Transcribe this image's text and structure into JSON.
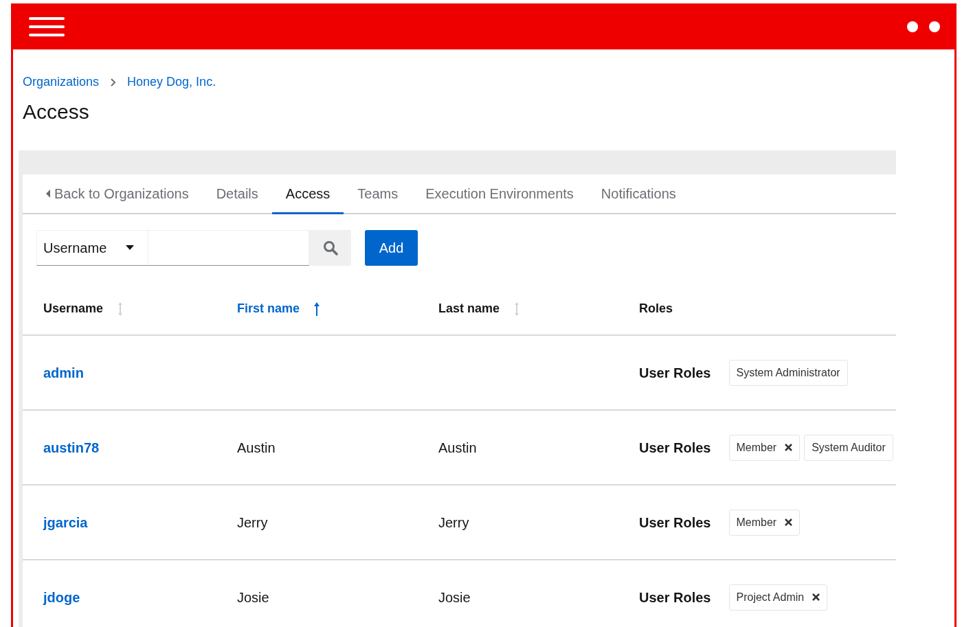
{
  "breadcrumb": [
    {
      "label": "Organizations"
    },
    {
      "label": "Honey Dog, Inc."
    }
  ],
  "title": "Access",
  "tabs": [
    {
      "label": "Back to Organizations",
      "kind": "back",
      "selected": false
    },
    {
      "label": "Details",
      "kind": "tab",
      "selected": false
    },
    {
      "label": "Access",
      "kind": "tab",
      "selected": true
    },
    {
      "label": "Teams",
      "kind": "tab",
      "selected": false
    },
    {
      "label": "Execution Environments",
      "kind": "tab",
      "selected": false
    },
    {
      "label": "Notifications",
      "kind": "tab",
      "selected": false
    }
  ],
  "toolbar": {
    "filter": "Username",
    "add_button": "Add"
  },
  "table": {
    "columns": [
      {
        "label": "Username",
        "sortable": true,
        "sorted": false
      },
      {
        "label": "First name",
        "sortable": true,
        "sorted": true
      },
      {
        "label": "Last name",
        "sortable": true,
        "sorted": false
      },
      {
        "label": "Roles",
        "sortable": false,
        "sorted": false
      }
    ],
    "rows": [
      {
        "username": "admin",
        "first_name": "",
        "last_name": "",
        "roles_label": "User Roles",
        "roles": [
          {
            "label": "System Administrator",
            "removable": false
          }
        ]
      },
      {
        "username": "austin78",
        "first_name": "Austin",
        "last_name": "Austin",
        "roles_label": "User Roles",
        "roles": [
          {
            "label": "Member",
            "removable": true
          },
          {
            "label": "System Auditor",
            "removable": false
          }
        ]
      },
      {
        "username": "jgarcia",
        "first_name": "Jerry",
        "last_name": "Jerry",
        "roles_label": "User Roles",
        "roles": [
          {
            "label": "Member",
            "removable": true
          }
        ]
      },
      {
        "username": "jdoge",
        "first_name": "Josie",
        "last_name": "Josie",
        "roles_label": "User Roles",
        "roles": [
          {
            "label": "Project Admin",
            "removable": true
          }
        ]
      }
    ]
  }
}
